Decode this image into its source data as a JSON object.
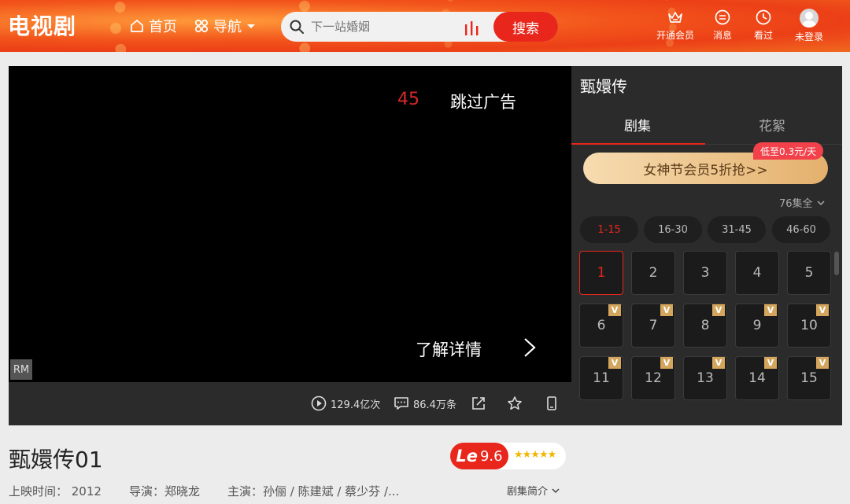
{
  "header": {
    "logo": "电视剧",
    "nav": {
      "home": "首页",
      "guide": "导航"
    },
    "search": {
      "placeholder": "下一站婚姻",
      "button": "搜索"
    },
    "icons": {
      "vip": "开通会员",
      "messages": "消息",
      "history": "看过",
      "login": "未登录"
    },
    "colors": {
      "brand": "#ec3f17",
      "accent": "#e8261c"
    }
  },
  "player": {
    "countdown": "45",
    "skip_ad": "跳过广告",
    "learn_more": "了解详情",
    "badge": "RM"
  },
  "player_bar": {
    "plays": "129.4亿次",
    "comments": "86.4万条"
  },
  "side": {
    "title": "甄嬛传",
    "tabs": [
      "剧集",
      "花絮"
    ],
    "promo": "女神节会员5折抢>>",
    "promo_tag": "低至0.3元/天",
    "episode_total": "76集全",
    "ranges": [
      "1-15",
      "16-30",
      "31-45",
      "46-60"
    ],
    "episodes": [
      {
        "num": "1",
        "vip": false,
        "active": true
      },
      {
        "num": "2",
        "vip": false
      },
      {
        "num": "3",
        "vip": false
      },
      {
        "num": "4",
        "vip": false
      },
      {
        "num": "5",
        "vip": false
      },
      {
        "num": "6",
        "vip": true
      },
      {
        "num": "7",
        "vip": true
      },
      {
        "num": "8",
        "vip": true
      },
      {
        "num": "9",
        "vip": true
      },
      {
        "num": "10",
        "vip": true
      },
      {
        "num": "11",
        "vip": true
      },
      {
        "num": "12",
        "vip": true
      },
      {
        "num": "13",
        "vip": true
      },
      {
        "num": "14",
        "vip": true
      },
      {
        "num": "15",
        "vip": true
      }
    ],
    "vip_tag": "V"
  },
  "info": {
    "episode_title": "甄嬛传01",
    "score_logo": "Le",
    "score": "9.6",
    "stars": "★★★★★",
    "year": "上映时间：  2012",
    "director": "导演：郑晓龙",
    "cast": "主演：孙俪 / 陈建斌 / 蔡少芬 /...",
    "synopsis": "剧集简介"
  }
}
